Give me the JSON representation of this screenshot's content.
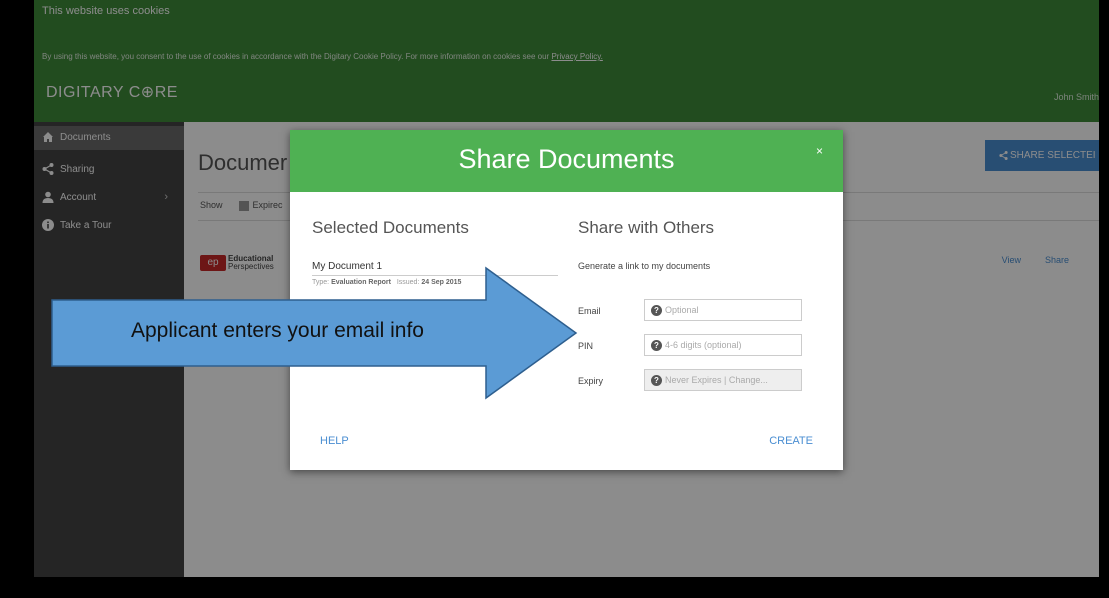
{
  "cookie": {
    "title": "This website uses cookies",
    "text": "By using this website, you consent to the use of cookies in accordance with the Digitary Cookie Policy. For more information on cookies see our ",
    "link": "Privacy Policy."
  },
  "header": {
    "brand": "DIGITARY C⊕RE",
    "user": "John Smith"
  },
  "sidebar": {
    "items": [
      {
        "label": "Documents",
        "icon": "home-icon"
      },
      {
        "label": "Sharing",
        "icon": "share-icon"
      },
      {
        "label": "Account",
        "icon": "user-icon"
      },
      {
        "label": "Take a Tour",
        "icon": "info-icon"
      }
    ]
  },
  "main": {
    "title": "Documer",
    "share_selected": "SHARE SELECTEI",
    "filter_show": "Show",
    "filter_expired": "Expirec",
    "logo_line1": "Educational",
    "logo_line2": "Perspectives",
    "row_view": "View",
    "row_share": "Share"
  },
  "modal": {
    "title": "Share Documents",
    "close": "×",
    "selected_heading": "Selected Documents",
    "doc_name": "My Document 1",
    "doc_type_label": "Type:",
    "doc_type": "Evaluation Report",
    "doc_issued_label": "Issued:",
    "doc_issued": "24 Sep 2015",
    "share_heading": "Share with Others",
    "generate_link": "Generate a link to my documents",
    "email_label": "Email",
    "email_placeholder": "Optional",
    "pin_label": "PIN",
    "pin_placeholder": "4-6 digits (optional)",
    "expiry_label": "Expiry",
    "expiry_value": "Never Expires | Change...",
    "help": "HELP",
    "create": "CREATE"
  },
  "annotation": {
    "text": "Applicant enters your email info"
  },
  "colors": {
    "green": "#3f8a3a",
    "modal_green": "#4fb153",
    "link_blue": "#4a8ed2",
    "arrow_blue": "#5b9bd5"
  }
}
